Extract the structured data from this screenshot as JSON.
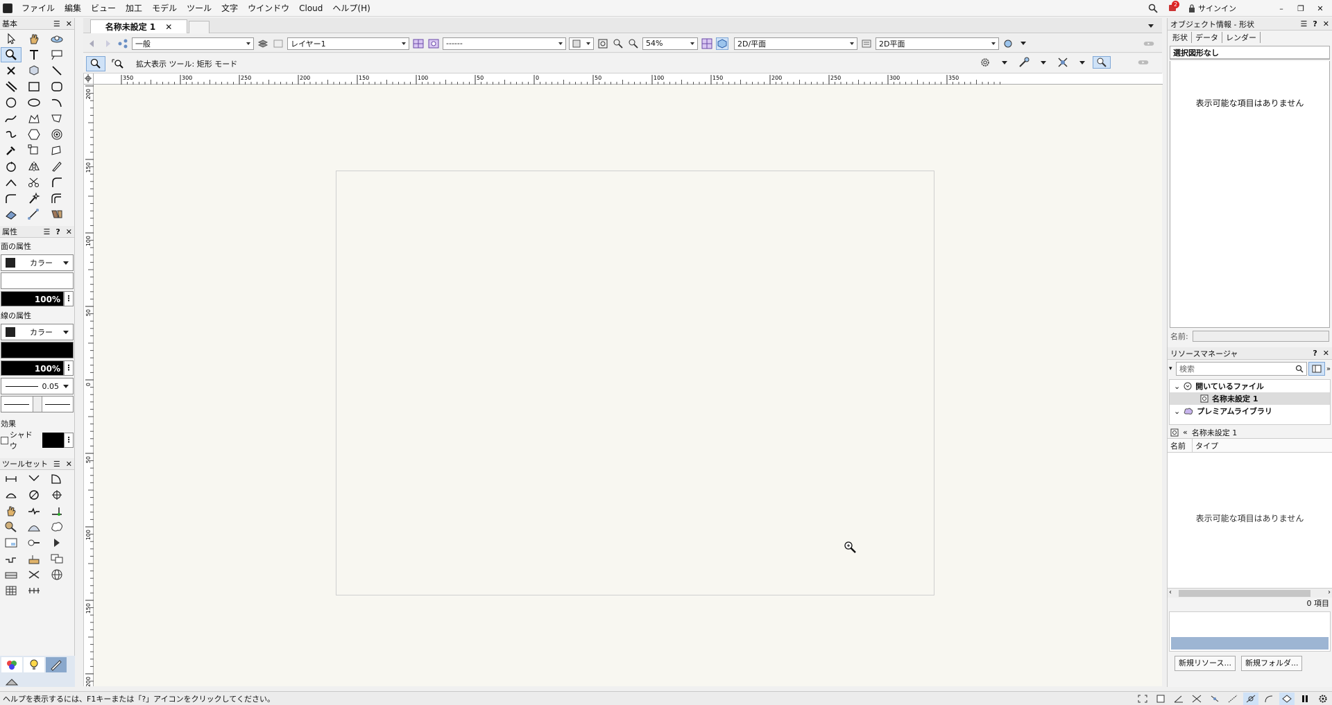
{
  "menubar": {
    "items": [
      "ファイル",
      "編集",
      "ビュー",
      "加工",
      "モデル",
      "ツール",
      "文字",
      "ウインドウ",
      "Cloud",
      "ヘルプ(H)"
    ],
    "notification_count": "2",
    "signin_label": "サインイン"
  },
  "tool_palette": {
    "title": "基本"
  },
  "attributes": {
    "title": "属性",
    "fill_label": "面の属性",
    "fill_type": "カラー",
    "fill_opacity": "100%",
    "line_label": "線の属性",
    "line_type": "カラー",
    "line_opacity": "100%",
    "line_weight": "0.05",
    "effects_label": "効果",
    "shadow_label": "シャドウ"
  },
  "toolset": {
    "title": "ツールセット"
  },
  "document": {
    "tab_title": "名称未設定 1"
  },
  "viewbar": {
    "class_value": "一般",
    "layer_value": "レイヤー1",
    "view_value": "------",
    "zoom_value": "54%",
    "projection_value": "2D/平面",
    "render_value": "2D平面"
  },
  "modebar": {
    "help_text": "拡大表示 ツール: 矩形 モード"
  },
  "ruler": {
    "top_labels": [
      "350",
      "300",
      "250",
      "200",
      "150",
      "100",
      "50",
      "0",
      "50",
      "100",
      "150",
      "200",
      "250",
      "300",
      "350"
    ],
    "left_labels": [
      "200",
      "150",
      "100",
      "50",
      "0",
      "50",
      "100",
      "150",
      "200"
    ]
  },
  "object_info": {
    "title": "オブジェクト情報 - 形状",
    "tabs": [
      "形状",
      "データ",
      "レンダー"
    ],
    "selection_title": "選択図形なし",
    "empty_message": "表示可能な項目はありません",
    "name_label": "名前:"
  },
  "resource_manager": {
    "title": "リソースマネージャ",
    "search_placeholder": "検索",
    "open_files_label": "開いているファイル",
    "file_name": "名称未設定 1",
    "premium_label": "プレミアムライブラリ",
    "current_file": "名称未設定 1",
    "col_name": "名前",
    "col_type": "タイプ",
    "empty_message": "表示可能な項目はありません",
    "item_count": "0 項目",
    "new_resource_btn": "新規リソース...",
    "new_folder_btn": "新規フォルダ..."
  },
  "statusbar": {
    "message": "ヘルプを表示するには、F1キーまたは「?」アイコンをクリックしてください。"
  }
}
